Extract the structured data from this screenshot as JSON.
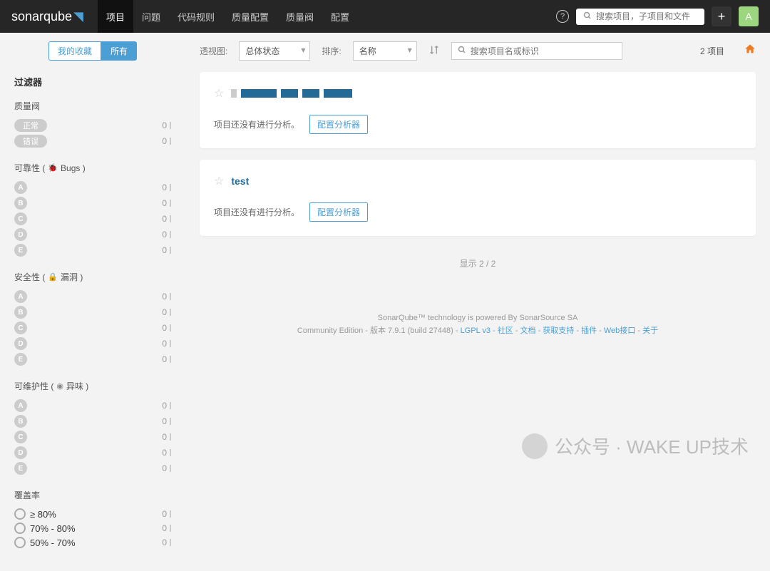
{
  "header": {
    "logo": "sonarqube",
    "nav": [
      "项目",
      "问题",
      "代码规则",
      "质量配置",
      "质量阀",
      "配置"
    ],
    "search_placeholder": "搜索项目，子项目和文件",
    "avatar_letter": "A"
  },
  "sidebar": {
    "tab_fav": "我的收藏",
    "tab_all": "所有",
    "filters_title": "过滤器",
    "groups": [
      {
        "title": "质量阀",
        "type": "pill",
        "items": [
          {
            "label": "正常",
            "count": "0"
          },
          {
            "label": "错误",
            "count": "0"
          }
        ]
      },
      {
        "title": "可靠性",
        "subtitle": "Bugs",
        "icon": "bug",
        "type": "rating",
        "items": [
          {
            "label": "A",
            "count": "0"
          },
          {
            "label": "B",
            "count": "0"
          },
          {
            "label": "C",
            "count": "0"
          },
          {
            "label": "D",
            "count": "0"
          },
          {
            "label": "E",
            "count": "0"
          }
        ]
      },
      {
        "title": "安全性",
        "subtitle": "漏洞",
        "icon": "lock",
        "type": "rating",
        "items": [
          {
            "label": "A",
            "count": "0"
          },
          {
            "label": "B",
            "count": "0"
          },
          {
            "label": "C",
            "count": "0"
          },
          {
            "label": "D",
            "count": "0"
          },
          {
            "label": "E",
            "count": "0"
          }
        ]
      },
      {
        "title": "可维护性",
        "subtitle": "异味",
        "icon": "radio",
        "type": "rating",
        "items": [
          {
            "label": "A",
            "count": "0"
          },
          {
            "label": "B",
            "count": "0"
          },
          {
            "label": "C",
            "count": "0"
          },
          {
            "label": "D",
            "count": "0"
          },
          {
            "label": "E",
            "count": "0"
          }
        ]
      },
      {
        "title": "覆盖率",
        "type": "coverage",
        "items": [
          {
            "label": "≥ 80%",
            "count": "0"
          },
          {
            "label": "70% - 80%",
            "count": "0"
          },
          {
            "label": "50% - 70%",
            "count": "0"
          }
        ]
      }
    ]
  },
  "toolbar": {
    "perspective_label": "透视图:",
    "perspective_value": "总体状态",
    "sort_label": "排序:",
    "sort_value": "名称",
    "search_placeholder": "搜索项目名或标识",
    "count": "2 项目"
  },
  "projects": [
    {
      "name_redacted": true,
      "no_analysis": "项目还没有进行分析。",
      "config_btn": "配置分析器"
    },
    {
      "name": "test",
      "no_analysis": "项目还没有进行分析。",
      "config_btn": "配置分析器"
    }
  ],
  "showing": "显示 2 / 2",
  "footer": {
    "line1": "SonarQube™ technology is powered By SonarSource SA",
    "line2_prefix": "Community Edition - 版本 7.9.1 (build 27448) - ",
    "links": [
      "LGPL v3",
      "社区",
      "文档",
      "获取支持",
      "插件",
      "Web接口",
      "关于"
    ]
  },
  "watermark": "公众号 · WAKE UP技术"
}
